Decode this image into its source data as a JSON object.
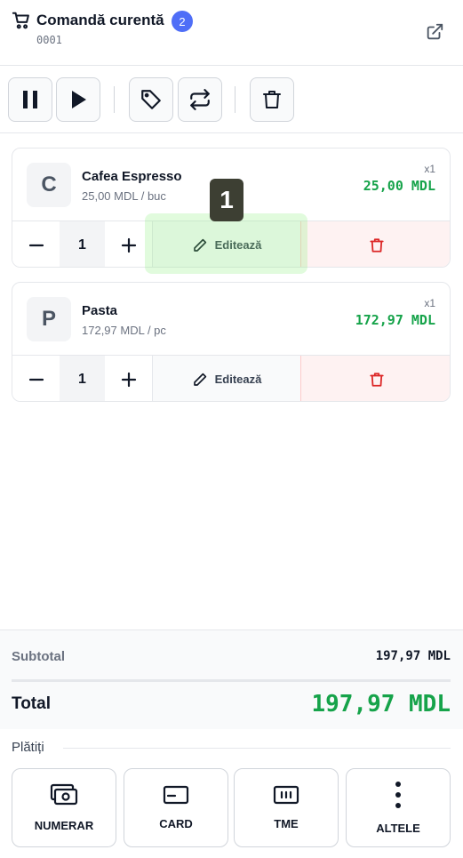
{
  "header": {
    "title": "Comandă curentă",
    "item_count": "2",
    "order_number": "0001"
  },
  "toolbar": {
    "buttons": [
      "pause-icon",
      "play-icon",
      "tag-icon",
      "swap-icon",
      "trash-icon"
    ]
  },
  "items": [
    {
      "initial": "C",
      "name": "Cafea Espresso",
      "unit_price": "25,00 MDL / buc",
      "qty_badge": "x1",
      "total": "25,00 MDL",
      "quantity": "1",
      "edit_label": "Editează"
    },
    {
      "initial": "P",
      "name": "Pasta",
      "unit_price": "172,97 MDL / pc",
      "qty_badge": "x1",
      "total": "172,97 MDL",
      "quantity": "1",
      "edit_label": "Editează"
    }
  ],
  "annotation": {
    "marker": "1"
  },
  "summary": {
    "subtotal_label": "Subtotal",
    "subtotal_value": "197,97 MDL",
    "total_label": "Total",
    "total_value": "197,97 MDL"
  },
  "payments": {
    "label": "Plătiți",
    "methods": [
      "NUMERAR",
      "CARD",
      "TME",
      "ALTELE"
    ]
  },
  "colors": {
    "accent": "#4f6ef7",
    "price_green": "#16a34a",
    "danger": "#dc2626"
  }
}
